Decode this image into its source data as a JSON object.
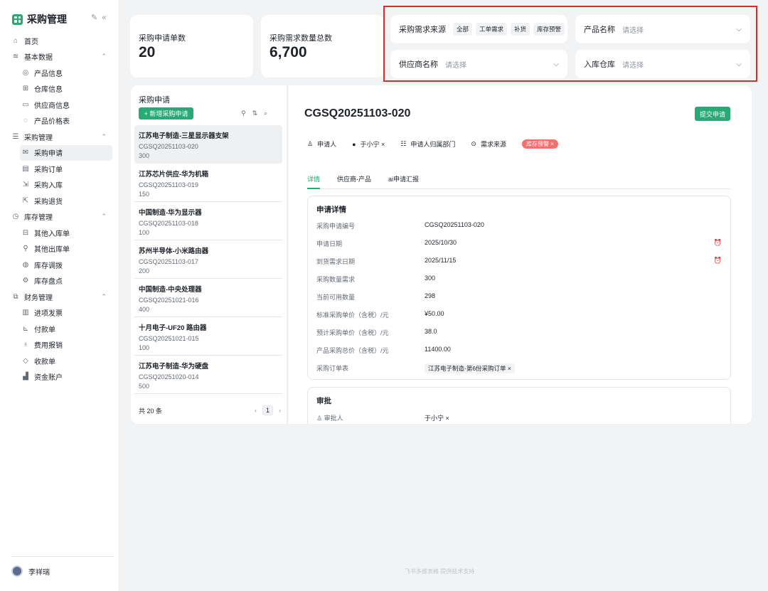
{
  "app": {
    "title": "采购管理"
  },
  "nav": {
    "items": [
      {
        "label": "首页",
        "icon": "home-icon",
        "glyph": "⌂",
        "level": 0
      },
      {
        "label": "基本数据",
        "icon": "layers-icon",
        "glyph": "≋",
        "level": 0,
        "caret": "⌃"
      },
      {
        "label": "产品信息",
        "icon": "globe-icon",
        "glyph": "◎",
        "level": 1
      },
      {
        "label": "仓库信息",
        "icon": "warehouse-icon",
        "glyph": "⊞",
        "level": 1
      },
      {
        "label": "供应商信息",
        "icon": "monitor-icon",
        "glyph": "▭",
        "level": 1
      },
      {
        "label": "产品价格表",
        "icon": "price-icon",
        "glyph": "◌",
        "level": 1
      },
      {
        "label": "采购管理",
        "icon": "list-icon",
        "glyph": "☰",
        "level": 0,
        "caret": "⌃"
      },
      {
        "label": "采购申请",
        "icon": "mail-icon",
        "glyph": "✉",
        "level": 1,
        "active": true
      },
      {
        "label": "采购订单",
        "icon": "calendar-icon",
        "glyph": "▤",
        "level": 1
      },
      {
        "label": "采购入库",
        "icon": "inbound-icon",
        "glyph": "⇲",
        "level": 1
      },
      {
        "label": "采购退货",
        "icon": "return-icon",
        "glyph": "⇱",
        "level": 1
      },
      {
        "label": "库存管理",
        "icon": "clock-icon",
        "glyph": "◷",
        "level": 0,
        "caret": "⌃"
      },
      {
        "label": "其他入库单",
        "icon": "inbox-icon",
        "glyph": "⊟",
        "level": 1
      },
      {
        "label": "其他出库单",
        "icon": "pin-icon",
        "glyph": "⚲",
        "level": 1
      },
      {
        "label": "库存调拨",
        "icon": "transfer-icon",
        "glyph": "◍",
        "level": 1
      },
      {
        "label": "库存盘点",
        "icon": "gear-icon",
        "glyph": "⚙",
        "level": 1
      },
      {
        "label": "财务管理",
        "icon": "copy-icon",
        "glyph": "⧉",
        "level": 0,
        "caret": "⌃"
      },
      {
        "label": "进项发票",
        "icon": "barcode-icon",
        "glyph": "▥",
        "level": 1
      },
      {
        "label": "付款单",
        "icon": "chart-icon",
        "glyph": "⊾",
        "level": 1
      },
      {
        "label": "费用报销",
        "icon": "bulb-icon",
        "glyph": "♁",
        "level": 1
      },
      {
        "label": "收款单",
        "icon": "shield-icon",
        "glyph": "◇",
        "level": 1
      },
      {
        "label": "资金账户",
        "icon": "bar-chart-icon",
        "glyph": "▟",
        "level": 1
      }
    ],
    "user": "李祥瑞"
  },
  "stats": [
    {
      "label": "采购申请单数",
      "value": "20"
    },
    {
      "label": "采购需求数量总数",
      "value": "6,700"
    }
  ],
  "filters": {
    "source_label": "采购需求来源",
    "source_chips": [
      "全部",
      "工单需求",
      "补货",
      "库存预警"
    ],
    "product_label": "产品名称",
    "product_placeholder": "请选择",
    "supplier_label": "供应商名称",
    "supplier_placeholder": "请选择",
    "warehouse_label": "入库仓库",
    "warehouse_placeholder": "请选择"
  },
  "list": {
    "title": "采购申请",
    "new_button": "+ 新增采购申请",
    "items": [
      {
        "title": "江苏电子制造-三星显示器支架",
        "code": "CGSQ20251103-020",
        "qty": "300"
      },
      {
        "title": "江苏芯片供应-华为机箱",
        "code": "CGSQ20251103-019",
        "qty": "150"
      },
      {
        "title": "中国制造-华为显示器",
        "code": "CGSQ20251103-018",
        "qty": "100"
      },
      {
        "title": "苏州半导体-小米路由器",
        "code": "CGSQ20251103-017",
        "qty": "200"
      },
      {
        "title": "中国制造-中央处理器",
        "code": "CGSQ20251021-016",
        "qty": "400"
      },
      {
        "title": "十月电子-UF20 路由器",
        "code": "CGSQ20251021-015",
        "qty": "100"
      },
      {
        "title": "江苏电子制造-华为硬盘",
        "code": "CGSQ20251020-014",
        "qty": "500"
      }
    ],
    "total": "共 20 条",
    "page": "1"
  },
  "detail": {
    "title": "CGSQ20251103-020",
    "submit": "提交申请",
    "applicant_label": "申请人",
    "applicant": "于小宁 ×",
    "dept_label": "申请人归属部门",
    "source_label": "需求来源",
    "source_tag": "库存预警 ×",
    "tabs": [
      "详情",
      "供应商-产品",
      "ai申请汇报"
    ],
    "section_title": "申请详情",
    "fields": [
      {
        "k": "采购申请编号",
        "v": "CGSQ20251103-020"
      },
      {
        "k": "申请日期",
        "v": "2025/10/30",
        "clock": true
      },
      {
        "k": "到货需求日期",
        "v": "2025/11/15",
        "clock": true
      },
      {
        "k": "采购数量需求",
        "v": "300"
      },
      {
        "k": "当前可用数量",
        "v": "298"
      },
      {
        "k": "标准采购单价（含税）/元",
        "v": "¥50.00"
      },
      {
        "k": "预计采购单价（含税）/元",
        "v": "38.0"
      },
      {
        "k": "产品采购总价（含税）/元",
        "v": "11400.00"
      },
      {
        "k": "采购订单表",
        "v": "江苏电子制造-第6份采购订单 ×",
        "tag": true
      }
    ],
    "approval_title": "审批",
    "approver_label": "审批人",
    "approver": "于小宁 ×"
  },
  "footer": "飞书多维表格 提供技术支持",
  "colors": {
    "accent": "#2aa876",
    "highlight": "#d92c2c",
    "warning_tag": "#f2706d"
  }
}
